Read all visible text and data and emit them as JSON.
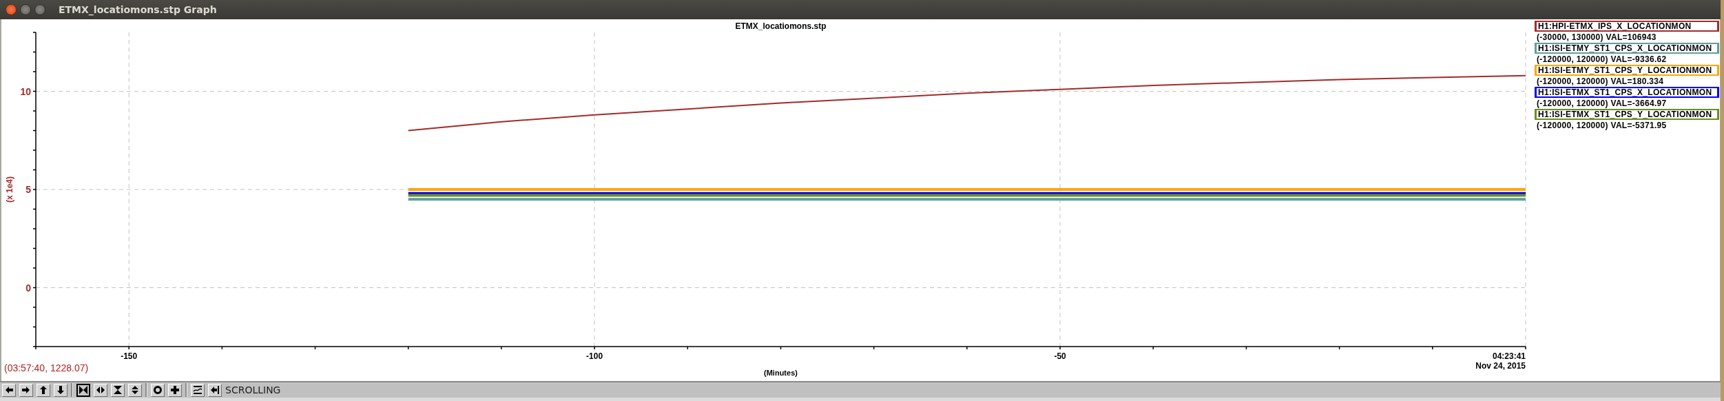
{
  "window": {
    "title": "ETMX_locatiomons.stp Graph"
  },
  "plot": {
    "chart_data": {
      "type": "line",
      "title": "ETMX_locatiomons.stp",
      "xlabel": "(Minutes)",
      "ylabel": "(x 1e4)",
      "x": [
        -120,
        -110,
        -100,
        -90,
        -80,
        -70,
        -60,
        -50,
        -40,
        -30,
        -20,
        -10,
        0
      ],
      "series": [
        {
          "name": "H1:HPI-ETMX_IPS_X_LOCATIONMON",
          "color": "#a52a2a",
          "values": [
            8.0,
            8.45,
            8.8,
            9.1,
            9.4,
            9.65,
            9.9,
            10.1,
            10.3,
            10.45,
            10.6,
            10.7,
            10.8
          ]
        },
        {
          "name": "H1:ISI-ETMY_ST1_CPS_X_LOCATIONMON",
          "color": "#5f9ea0",
          "values": [
            4.5,
            4.5,
            4.5,
            4.5,
            4.5,
            4.5,
            4.5,
            4.5,
            4.5,
            4.5,
            4.5,
            4.5,
            4.5
          ]
        },
        {
          "name": "H1:ISI-ETMY_ST1_CPS_Y_LOCATIONMON",
          "color": "#ffa500",
          "values": [
            5.0,
            5.0,
            5.0,
            5.0,
            5.0,
            5.0,
            5.0,
            5.0,
            5.0,
            5.0,
            5.0,
            5.0,
            5.0
          ]
        },
        {
          "name": "H1:ISI-ETMX_ST1_CPS_X_LOCATIONMON",
          "color": "#0000ff",
          "values": [
            4.8,
            4.8,
            4.8,
            4.8,
            4.8,
            4.8,
            4.8,
            4.8,
            4.8,
            4.8,
            4.8,
            4.8,
            4.8
          ]
        },
        {
          "name": "H1:ISI-ETMX_ST1_CPS_Y_LOCATIONMON",
          "color": "#6b8e23",
          "values": [
            4.7,
            4.7,
            4.7,
            4.7,
            4.7,
            4.7,
            4.7,
            4.7,
            4.7,
            4.7,
            4.7,
            4.7,
            4.7
          ]
        }
      ],
      "grid": true,
      "xlim": [
        -160,
        0
      ],
      "ylim": [
        -3,
        13
      ],
      "xticks": [
        -150,
        -100,
        -50,
        {
          "value": 0,
          "label": "04:23:41\nNov 24, 2015"
        }
      ],
      "yticks": [
        0,
        5,
        10
      ]
    }
  },
  "legend": [
    {
      "reading": "(-30000, 130000) VAL=106943"
    },
    {
      "reading": "(-120000, 120000) VAL=-9336.62"
    },
    {
      "reading": "(-120000, 120000) VAL=180.334"
    },
    {
      "reading": "(-120000, 120000) VAL=-3664.97"
    },
    {
      "reading": "(-120000, 120000) VAL=-5371.95"
    }
  ],
  "cursor_readout": "(03:57:40, 1228.07)",
  "toolbar": {
    "buttons": [
      {
        "selected": false
      },
      {
        "selected": false
      },
      {
        "selected": false
      },
      {
        "selected": false
      },
      {
        "selected": true
      },
      {
        "selected": false
      },
      {
        "selected": false
      },
      {
        "selected": false
      },
      {
        "selected": false
      },
      {
        "selected": false
      },
      {
        "selected": false
      },
      {
        "selected": false
      }
    ],
    "mode": "SCROLLING"
  }
}
